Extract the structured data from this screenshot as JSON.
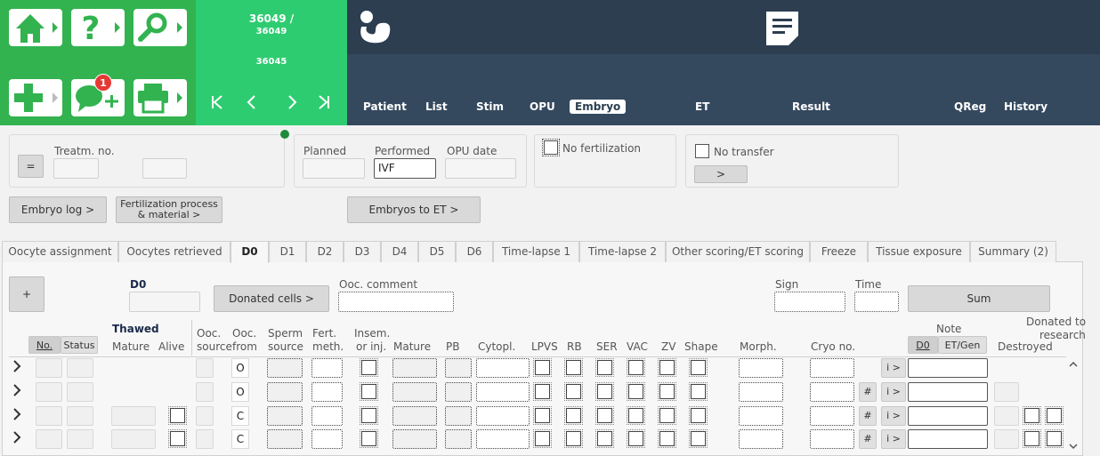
{
  "toolbar": {
    "home_icon": "home-icon",
    "help_icon": "help-icon",
    "search_icon": "search-icon",
    "add_icon": "add-icon",
    "message_icon": "message-add-icon",
    "message_badge": "1",
    "print_icon": "printer-icon"
  },
  "patient": {
    "id_line1": "36049 /",
    "id_line2": "36049",
    "id_line3": "36045"
  },
  "nav": {
    "first": "K",
    "prev": "<",
    "next": ">",
    "last": ">I",
    "items": [
      "Patient",
      "List",
      "Stim",
      "OPU",
      "Embryo",
      "ET",
      "Result",
      "QReg",
      "History"
    ],
    "active": "Embryo"
  },
  "form": {
    "eq_button": "=",
    "treatm_label": "Treatm. no.",
    "planned_label": "Planned",
    "performed_label": "Performed",
    "performed_value": "IVF",
    "opu_date_label": "OPU date",
    "no_fertilization": "No fertilization",
    "no_transfer": "No transfer",
    "transfer_button": ">",
    "embryo_log": "Embryo log >",
    "fert_process_1": "Fertilization process",
    "fert_process_2": "& material >",
    "embryos_to_et": "Embryos to ET >"
  },
  "tabs": [
    "Oocyte assignment",
    "Oocytes retrieved",
    "D0",
    "D1",
    "D2",
    "D3",
    "D4",
    "D5",
    "D6",
    "Time-lapse 1",
    "Time-lapse 2",
    "Other scoring/ET scoring",
    "Freeze",
    "Tissue exposure",
    "Summary (2)"
  ],
  "active_tab": "D0",
  "d0": {
    "add_button": "+",
    "title": "D0",
    "donated_cells": "Donated cells >",
    "ooc_comment_label": "Ooc. comment",
    "sign_label": "Sign",
    "time_label": "Time",
    "sum_button": "Sum",
    "thawed_label": "Thawed",
    "note_label": "Note",
    "donated_label_1": "Donated to",
    "donated_label_2": "research",
    "note_tab_d0": "D0",
    "note_tab_et": "ET/Gen",
    "headers": {
      "no": "No.",
      "status": "Status",
      "mature": "Mature",
      "alive": "Alive",
      "ooc_source_1": "Ooc.",
      "ooc_source_2": "source",
      "ooc_from_1": "Ooc.",
      "ooc_from_2": "from",
      "sperm_1": "Sperm",
      "sperm_2": "source",
      "fert_1": "Fert.",
      "fert_2": "meth.",
      "insem_1": "Insem.",
      "insem_2": "or inj.",
      "mature2": "Mature",
      "pb": "PB",
      "cytopl": "Cytopl.",
      "lpvs": "LPVS",
      "rb": "RB",
      "ser": "SER",
      "vac": "VAC",
      "zv": "ZV",
      "shape": "Shape",
      "morph": "Morph.",
      "cryo": "Cryo no.",
      "destroyed": "Destroyed"
    },
    "rows": [
      {
        "ooc_from": "O",
        "hash": "",
        "info": "i >"
      },
      {
        "ooc_from": "O",
        "hash": "#",
        "info": "i >"
      },
      {
        "ooc_from": "C",
        "hash": "#",
        "info": "i >"
      },
      {
        "ooc_from": "C",
        "hash": "#",
        "info": "i >"
      }
    ]
  }
}
